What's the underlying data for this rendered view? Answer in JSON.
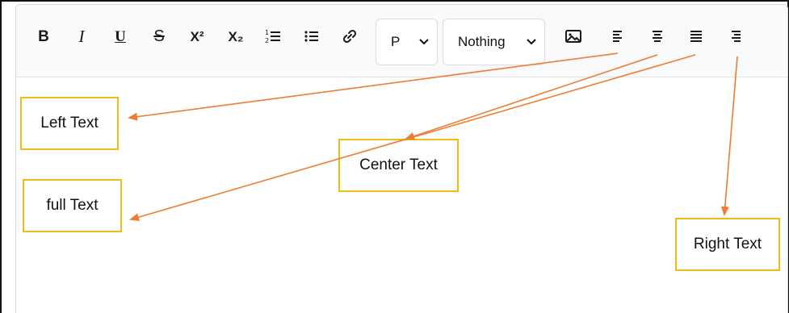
{
  "toolbar": {
    "buttons": [
      {
        "name": "bold-button",
        "label": "B"
      },
      {
        "name": "italic-button",
        "label": "I"
      },
      {
        "name": "underline-button",
        "label": "U"
      },
      {
        "name": "strikethrough-button",
        "label": "S"
      },
      {
        "name": "superscript-button",
        "label": "X²"
      },
      {
        "name": "subscript-button",
        "label": "X₂"
      },
      {
        "name": "ordered-list-button",
        "icon": "ordered-list-icon"
      },
      {
        "name": "unordered-list-button",
        "icon": "unordered-list-icon"
      },
      {
        "name": "link-button",
        "icon": "link-icon"
      },
      {
        "name": "image-button",
        "icon": "image-icon"
      },
      {
        "name": "align-left-button",
        "icon": "align-left-icon"
      },
      {
        "name": "align-center-button",
        "icon": "align-center-icon"
      },
      {
        "name": "align-justify-button",
        "icon": "align-justify-icon"
      },
      {
        "name": "align-right-button",
        "icon": "align-right-icon"
      }
    ],
    "block_select": {
      "value": "P"
    },
    "style_select": {
      "value": "Nothing"
    }
  },
  "callouts": {
    "left": "Left Text",
    "center": "Center Text",
    "full": "full Text",
    "right": "Right Text"
  },
  "colors": {
    "arrow": "#ee7d31",
    "callout_border": "#f1bb13",
    "outer_border": "#111111"
  }
}
